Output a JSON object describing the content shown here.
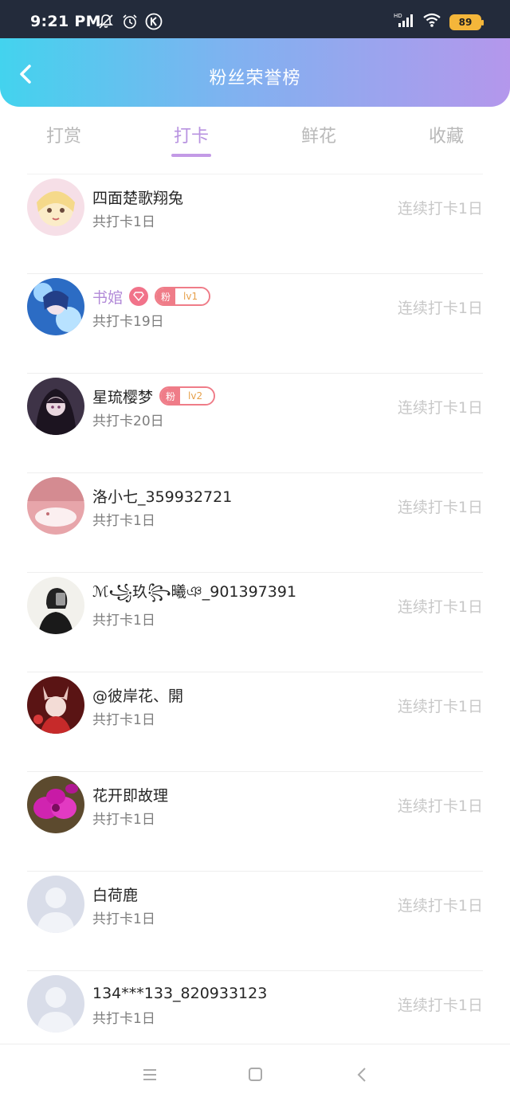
{
  "status_bar": {
    "time": "9:21 PM",
    "icons": [
      "bell-off-icon",
      "alarm-icon",
      "k-app-icon",
      "hd-signal-icon",
      "wifi-icon"
    ],
    "battery": "89",
    "battery_color": "#f4b63a"
  },
  "header": {
    "title": "粉丝荣誉榜",
    "gradient": [
      "#43d3ee",
      "#b497ec"
    ]
  },
  "tabs": [
    {
      "label": "打赏",
      "active": false
    },
    {
      "label": "打卡",
      "active": true
    },
    {
      "label": "鲜花",
      "active": false
    },
    {
      "label": "收藏",
      "active": false
    }
  ],
  "accent_color": "#b893e0",
  "list": [
    {
      "name": "四面楚歌翔兔",
      "total": "共打卡1日",
      "streak": "连续打卡1日"
    },
    {
      "name": "书婠",
      "total": "共打卡19日",
      "streak": "连续打卡1日",
      "badge": "粉",
      "level": "lv1"
    },
    {
      "name": "星琉樱梦",
      "total": "共打卡20日",
      "streak": "连续打卡1日",
      "badge": "粉",
      "level": "lv2"
    },
    {
      "name": "洛小七_359932721",
      "total": "共打卡1日",
      "streak": "连续打卡1日"
    },
    {
      "name": "ℳ꧁玖꧂曦ঞ_901397391",
      "total": "共打卡1日",
      "streak": "连续打卡1日"
    },
    {
      "name": "@彼岸花、開",
      "total": "共打卡1日",
      "streak": "连续打卡1日"
    },
    {
      "name": "花开即故理",
      "total": "共打卡1日",
      "streak": "连续打卡1日"
    },
    {
      "name": "白荷鹿",
      "total": "共打卡1日",
      "streak": "连续打卡1日"
    },
    {
      "name": "134***133_820933123",
      "total": "共打卡1日",
      "streak": "连续打卡1日"
    }
  ],
  "bottom_nav": [
    "menu-icon",
    "home-square-icon",
    "back-chevron-icon"
  ]
}
